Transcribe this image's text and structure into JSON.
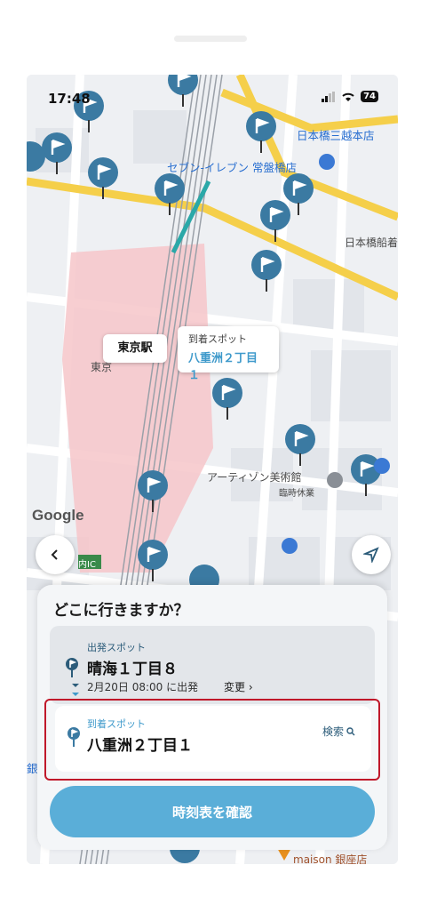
{
  "status_bar": {
    "time": "17:48",
    "battery": "74"
  },
  "map": {
    "labels": {
      "nihonbashi_mitsukoshi": "日本橋三越本店",
      "seven_eleven": "セブン-イレブン 常盤橋店",
      "nihonbashi_funa": "日本橋船着",
      "tokyo_station_small": "東京",
      "artizon": "アーティゾン美術館",
      "closed": "臨時休業",
      "uchi_ic": "内IC",
      "maison": "maison 銀座店",
      "gin": "銀"
    },
    "google": "Google",
    "station_card": "東京駅",
    "arrival_card": {
      "label": "到着スポット",
      "value": "八重洲２丁目１"
    }
  },
  "panel": {
    "title": "どこに行きますか？",
    "origin": {
      "label": "出発スポット",
      "name": "晴海１丁目８",
      "departure": "2月20日 08:00 に出発",
      "change": "変更 ›"
    },
    "destination": {
      "label": "到着スポット",
      "name": "八重洲２丁目１",
      "search": "検索"
    },
    "timetable_button": "時刻表を確認"
  },
  "colors": {
    "accent": "#5aaed8",
    "pin": "#3b7aa2",
    "highlight": "#c0182a"
  }
}
